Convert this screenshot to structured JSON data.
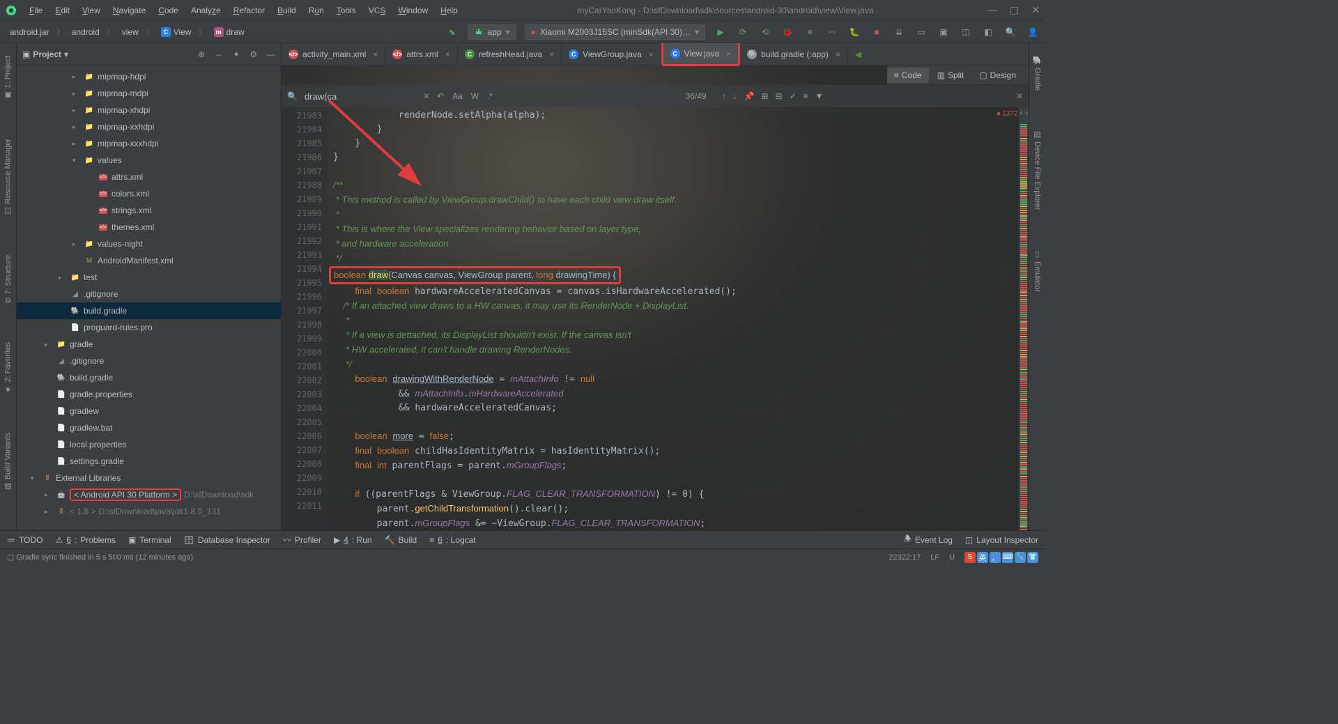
{
  "window": {
    "title": "myCarYaoKong - D:\\sfDownload\\sdk\\sources\\android-30\\android\\view\\View.java"
  },
  "menus": [
    "File",
    "Edit",
    "View",
    "Navigate",
    "Code",
    "Analyze",
    "Refactor",
    "Build",
    "Run",
    "Tools",
    "VCS",
    "Window",
    "Help"
  ],
  "breadcrumbs": [
    {
      "label": "android.jar",
      "kind": "jar"
    },
    {
      "label": "android",
      "kind": "pkg"
    },
    {
      "label": "view",
      "kind": "pkg"
    },
    {
      "label": "View",
      "kind": "class"
    },
    {
      "label": "draw",
      "kind": "method"
    }
  ],
  "run_config": "app",
  "device": "Xiaomi M2003J15SC (minSdk(API 30)…",
  "project": {
    "title": "Project",
    "tree": [
      {
        "depth": 3,
        "arrow": ">",
        "icon": "folder",
        "label": "mipmap-hdpi"
      },
      {
        "depth": 3,
        "arrow": ">",
        "icon": "folder",
        "label": "mipmap-mdpi"
      },
      {
        "depth": 3,
        "arrow": ">",
        "icon": "folder",
        "label": "mipmap-xhdpi"
      },
      {
        "depth": 3,
        "arrow": ">",
        "icon": "folder",
        "label": "mipmap-xxhdpi"
      },
      {
        "depth": 3,
        "arrow": ">",
        "icon": "folder",
        "label": "mipmap-xxxhdpi"
      },
      {
        "depth": 3,
        "arrow": "v",
        "icon": "folder",
        "label": "values"
      },
      {
        "depth": 4,
        "arrow": "",
        "icon": "xml",
        "label": "attrs.xml"
      },
      {
        "depth": 4,
        "arrow": "",
        "icon": "xml",
        "label": "colors.xml"
      },
      {
        "depth": 4,
        "arrow": "",
        "icon": "xml",
        "label": "strings.xml"
      },
      {
        "depth": 4,
        "arrow": "",
        "icon": "xml",
        "label": "themes.xml"
      },
      {
        "depth": 3,
        "arrow": ">",
        "icon": "folder",
        "label": "values-night"
      },
      {
        "depth": 3,
        "arrow": "",
        "icon": "manifest",
        "label": "AndroidManifest.xml"
      },
      {
        "depth": 2,
        "arrow": ">",
        "icon": "folder",
        "label": "test"
      },
      {
        "depth": 2,
        "arrow": "",
        "icon": "gitignore",
        "label": ".gitignore"
      },
      {
        "depth": 2,
        "arrow": "",
        "icon": "gradle",
        "label": "build.gradle",
        "sel": true
      },
      {
        "depth": 2,
        "arrow": "",
        "icon": "file",
        "label": "proguard-rules.pro"
      },
      {
        "depth": 1,
        "arrow": ">",
        "icon": "folder",
        "label": "gradle"
      },
      {
        "depth": 1,
        "arrow": "",
        "icon": "gitignore",
        "label": ".gitignore"
      },
      {
        "depth": 1,
        "arrow": "",
        "icon": "gradle",
        "label": "build.gradle"
      },
      {
        "depth": 1,
        "arrow": "",
        "icon": "file",
        "label": "gradle.properties"
      },
      {
        "depth": 1,
        "arrow": "",
        "icon": "file",
        "label": "gradlew"
      },
      {
        "depth": 1,
        "arrow": "",
        "icon": "file",
        "label": "gradlew.bat"
      },
      {
        "depth": 1,
        "arrow": "",
        "icon": "file",
        "label": "local.properties"
      },
      {
        "depth": 1,
        "arrow": "",
        "icon": "file",
        "label": "settings.gradle"
      },
      {
        "depth": 0,
        "arrow": "v",
        "icon": "lib",
        "label": "External Libraries"
      },
      {
        "depth": 1,
        "arrow": ">",
        "icon": "android",
        "label": "< Android API 30 Platform >",
        "suffix": "D:\\sfDownload\\sdk",
        "hl": true
      },
      {
        "depth": 1,
        "arrow": ">",
        "icon": "lib",
        "label": "< 1.8 >",
        "suffix": "D:\\sfDownload\\java\\jdk1.8.0_131",
        "dim": true
      }
    ]
  },
  "left_tabs": [
    "1: Project",
    "Resource Manager",
    "7: Structure",
    "2: Favorites",
    "Build Variants"
  ],
  "right_tabs": [
    "Gradle",
    "Device File Explorer",
    "Emulator"
  ],
  "editor": {
    "tabs": [
      {
        "label": "activity_main.xml",
        "icon": "xml",
        "color": "#c75450"
      },
      {
        "label": "attrs.xml",
        "icon": "xml",
        "color": "#c75450"
      },
      {
        "label": "refreshHead.java",
        "icon": "class",
        "color": "#4a8f3c"
      },
      {
        "label": "ViewGroup.java",
        "icon": "class",
        "color": "#2b7de9"
      },
      {
        "label": "View.java",
        "icon": "class",
        "color": "#2b7de9",
        "hl": true,
        "active": true
      },
      {
        "label": "build.gradle (:app)",
        "icon": "gradle",
        "color": "#87939a"
      }
    ],
    "view_modes": [
      "Code",
      "Split",
      "Design"
    ],
    "search": {
      "value": "draw(ca",
      "count": "36/49"
    },
    "problems": "1372",
    "lines_start": 21983,
    "code_lines": [
      {
        "n": 21983,
        "t": "            renderNode.setAlpha(alpha);"
      },
      {
        "n": 21984,
        "t": "        }"
      },
      {
        "n": 21985,
        "t": "    }"
      },
      {
        "n": 21986,
        "t": "}"
      },
      {
        "n": 21987,
        "t": ""
      },
      {
        "n": 21988,
        "t": "/**"
      },
      {
        "n": 21989,
        "t": " * This method is called by ViewGroup.drawChild() to have each child view draw itself."
      },
      {
        "n": 21990,
        "t": " *"
      },
      {
        "n": 21991,
        "t": " * This is where the View specializes rendering behavior based on layer type,"
      },
      {
        "n": 21992,
        "t": " * and hardware acceleration."
      },
      {
        "n": 21993,
        "t": " */"
      },
      {
        "n": 21994,
        "method": true
      },
      {
        "n": 21995,
        "t": "    final boolean hardwareAcceleratedCanvas = canvas.isHardwareAccelerated();"
      },
      {
        "n": 21996,
        "t": "    /* If an attached view draws to a HW canvas, it may use its RenderNode + DisplayList."
      },
      {
        "n": 21997,
        "t": "     *"
      },
      {
        "n": 21998,
        "t": "     * If a view is dettached, its DisplayList shouldn't exist. If the canvas isn't"
      },
      {
        "n": 21999,
        "t": "     * HW accelerated, it can't handle drawing RenderNodes."
      },
      {
        "n": 22000,
        "t": "     */"
      },
      {
        "n": 22001,
        "t": "    boolean drawingWithRenderNode = mAttachInfo != null"
      },
      {
        "n": 22002,
        "t": "            && mAttachInfo.mHardwareAccelerated"
      },
      {
        "n": 22003,
        "t": "            && hardwareAcceleratedCanvas;"
      },
      {
        "n": 22004,
        "t": ""
      },
      {
        "n": 22005,
        "t": "    boolean more = false;"
      },
      {
        "n": 22006,
        "t": "    final boolean childHasIdentityMatrix = hasIdentityMatrix();"
      },
      {
        "n": 22007,
        "t": "    final int parentFlags = parent.mGroupFlags;"
      },
      {
        "n": 22008,
        "t": ""
      },
      {
        "n": 22009,
        "t": "    if ((parentFlags & ViewGroup.FLAG_CLEAR_TRANSFORMATION) != 0) {"
      },
      {
        "n": 22010,
        "t": "        parent.getChildTransformation().clear();"
      },
      {
        "n": 22011,
        "t": "        parent.mGroupFlags &= ~ViewGroup.FLAG_CLEAR_TRANSFORMATION;"
      }
    ]
  },
  "bottom_tools": {
    "left": [
      "TODO",
      "6: Problems",
      "Terminal",
      "Database Inspector",
      "Profiler",
      "4: Run",
      "Build",
      "6: Logcat"
    ],
    "right": [
      "Event Log",
      "Layout Inspector"
    ]
  },
  "status": {
    "msg": "Gradle sync finished in 5 s 500 ms (12 minutes ago)",
    "pos": "22322:17",
    "le": "LF",
    "enc": "U"
  }
}
